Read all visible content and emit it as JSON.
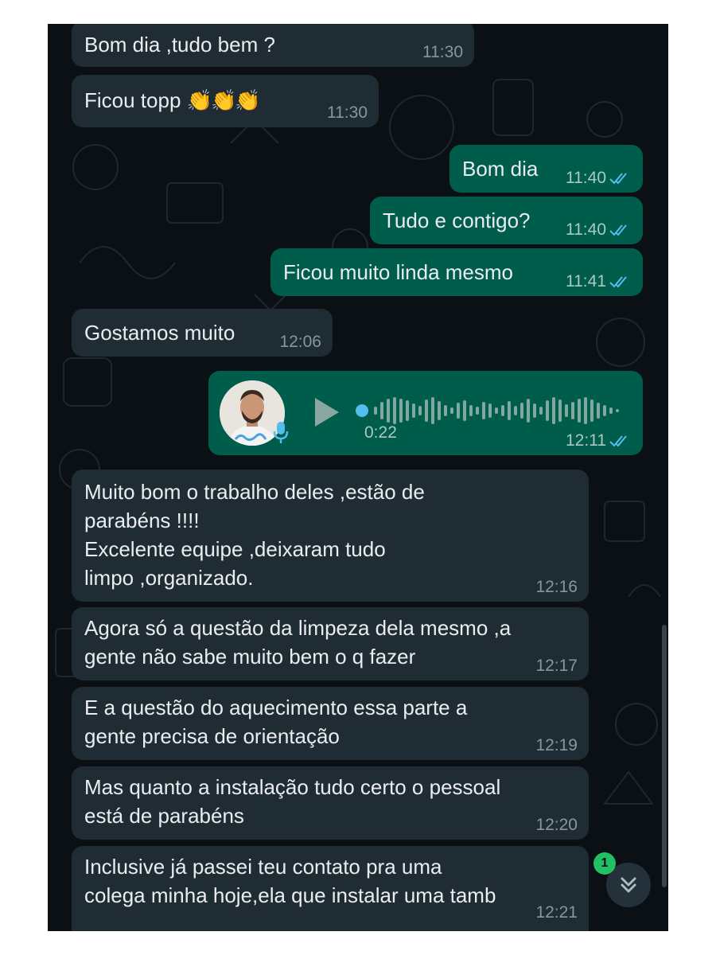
{
  "chat": {
    "messages": [
      {
        "text": "Bom dia ,tudo  bem ?",
        "time": "11:30",
        "direction": "incoming"
      },
      {
        "text": "Ficou topp",
        "emoji": "👏👏👏",
        "time": "11:30",
        "direction": "incoming"
      },
      {
        "text": "Bom dia",
        "time": "11:40",
        "direction": "outgoing",
        "status": "read"
      },
      {
        "text": "Tudo e contigo?",
        "time": "11:40",
        "direction": "outgoing",
        "status": "read"
      },
      {
        "text": "Ficou muito linda mesmo",
        "time": "11:41",
        "direction": "outgoing",
        "status": "read"
      },
      {
        "text": "Gostamos muito",
        "time": "12:06",
        "direction": "incoming"
      },
      {
        "type": "voice",
        "duration": "0:22",
        "time": "12:11",
        "direction": "outgoing",
        "status": "read",
        "progress": 0.0
      },
      {
        "text": "Muito bom o trabalho  deles ,estão de\nparabéns  !!!!\nExcelente equipe  ,deixaram tudo\nlimpo ,organizado.",
        "time": "12:16",
        "direction": "incoming"
      },
      {
        "text": "Agora só a questão da limpeza  dela mesmo ,a\ngente não sabe  muito bem o q fazer",
        "time": "12:17",
        "direction": "incoming"
      },
      {
        "text": "E a questão  do aquecimento   essa parte a\ngente precisa de orientação",
        "time": "12:19",
        "direction": "incoming"
      },
      {
        "text": "Mas quanto a instalação  tudo certo o pessoal\nestá de parabéns",
        "time": "12:20",
        "direction": "incoming"
      },
      {
        "text": "Inclusive  já passei teu contato   pra uma\ncolega minha hoje,ela  que instalar uma tamb",
        "time": "12:21",
        "direction": "incoming"
      }
    ]
  },
  "scroll_button": {
    "unread_count": "1",
    "icon": "double-chevron-down-icon"
  },
  "colors": {
    "background": "#0b1014",
    "incoming_bubble": "#202c33",
    "outgoing_bubble": "#005c4b",
    "read_ticks": "#53bdeb",
    "unread_badge": "#21c063"
  }
}
